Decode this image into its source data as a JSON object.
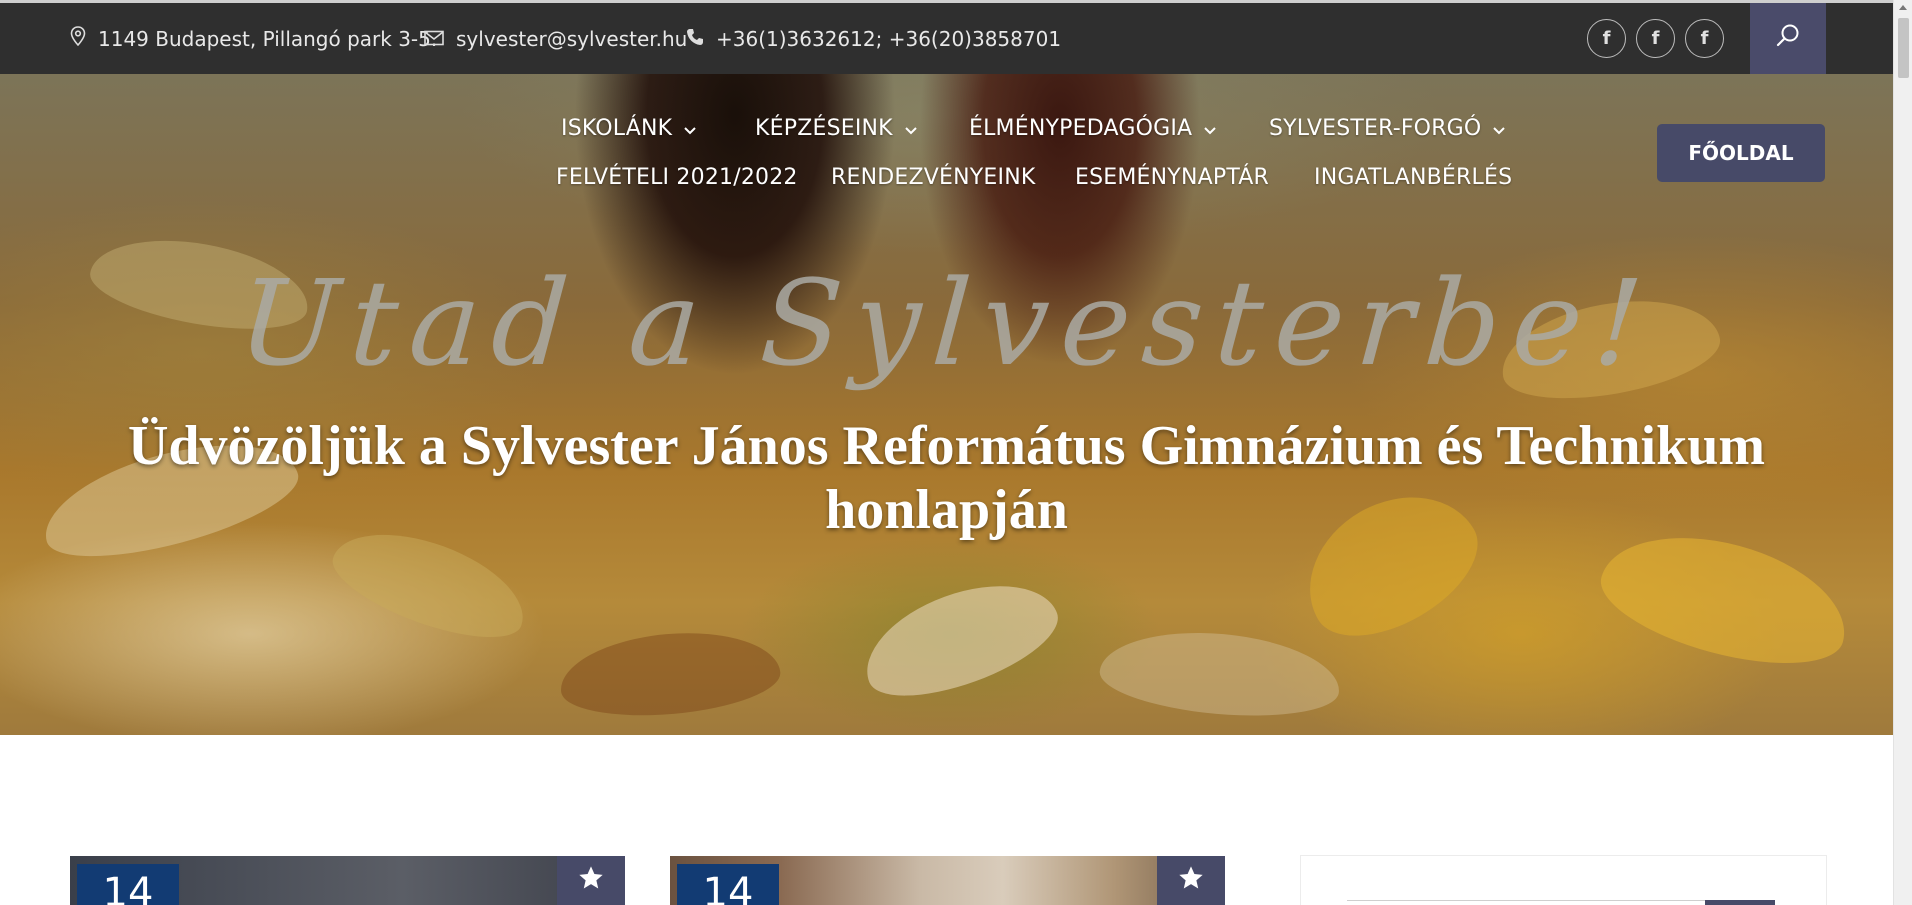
{
  "topbar": {
    "address": "1149 Budapest, Pillangó park 3-5.",
    "email": "sylvester@sylvester.hu",
    "phone": "+36(1)3632612; +36(20)3858701",
    "social_glyph": "f",
    "icons": [
      "location-pin-icon",
      "mail-icon",
      "phone-icon",
      "facebook-icon",
      "search-icon"
    ]
  },
  "nav": {
    "row1": [
      {
        "label": "ISKOLÁNK",
        "has_dropdown": true
      },
      {
        "label": "KÉPZÉSEINK",
        "has_dropdown": true
      },
      {
        "label": "ÉLMÉNYPEDAGÓGIA",
        "has_dropdown": true
      },
      {
        "label": "SYLVESTER-FORGÓ",
        "has_dropdown": true
      }
    ],
    "row2": [
      {
        "label": "FELVÉTELI 2021/2022"
      },
      {
        "label": "RENDEZVÉNYEINK"
      },
      {
        "label": "ESEMÉNYNAPTÁR"
      },
      {
        "label": "INGATLANBÉRLÉS"
      }
    ],
    "home_button": "FŐOLDAL"
  },
  "hero": {
    "script_title": "Utad a Sylvesterbe!",
    "welcome": "Üdvözöljük a Sylvester János Református Gimnázium és Technikum honlapján"
  },
  "cards": [
    {
      "day": "14",
      "icon": "star-icon"
    },
    {
      "day": "14",
      "icon": "star-icon"
    }
  ],
  "colors": {
    "topbar_bg": "#2f2f2f",
    "accent": "#474a68",
    "date_badge": "#123b73"
  }
}
